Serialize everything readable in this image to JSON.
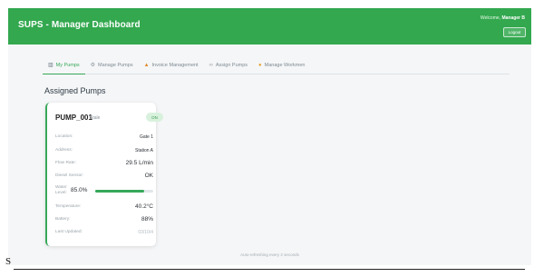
{
  "header": {
    "title": "SUPS - Manager Dashboard",
    "welcome_prefix": "Welcome, ",
    "user_name": "Manager B",
    "logout_label": "Logout"
  },
  "tabs": [
    {
      "label": "My Pumps",
      "icon": "pump-icon",
      "active": true
    },
    {
      "label": "Manage Pumps",
      "icon": "settings-icon",
      "active": false
    },
    {
      "label": "Invoice Management",
      "icon": "fire-icon",
      "active": false
    },
    {
      "label": "Assign Pumps",
      "icon": "link-icon",
      "active": false
    },
    {
      "label": "Manage Workmen",
      "icon": "worker-icon",
      "active": false
    }
  ],
  "section_title": "Assigned Pumps",
  "pump": {
    "name": "PUMP_001",
    "state": "Stale",
    "status_badge": "ON",
    "fields": {
      "location_label": "Location:",
      "location_value": "Gate 1",
      "address_label": "Address:",
      "address_value": "Station A",
      "flow_label": "Flow Rate:",
      "flow_value": "29.5 L/min",
      "diesel_label": "Diesel Sensor:",
      "diesel_value": "OK",
      "water_label": "Water Level:",
      "water_value": "85.0%",
      "water_fraction": 0.85,
      "temp_label": "Temperature:",
      "temp_value": "40.2°C",
      "battery_label": "Battery:",
      "battery_value": "88%",
      "updated_label": "Last Updated:",
      "updated_value": "03/10/4"
    }
  },
  "footer_note": "Auto-refreshing every 2 seconds",
  "stray_text": "S",
  "colors": {
    "brand": "#33a84f",
    "accent": "#37a85a"
  }
}
